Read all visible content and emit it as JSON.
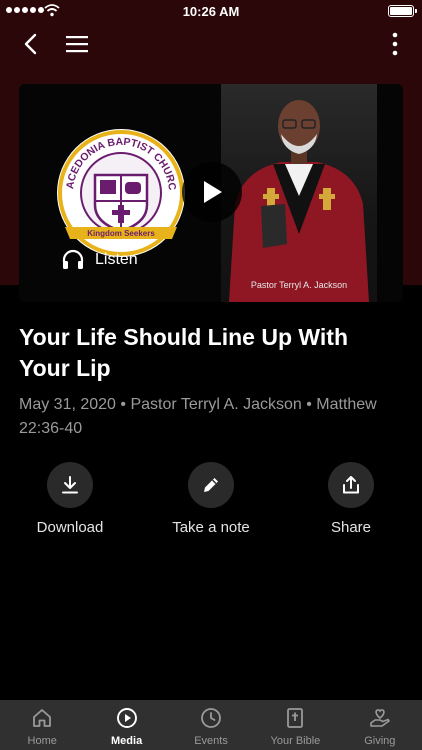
{
  "status_bar": {
    "time": "10:26 AM"
  },
  "hero": {
    "listen_label": "Listen",
    "photo_caption": "Pastor Terryl A. Jackson",
    "logo": {
      "church_name": "MACEDONIA BAPTIST CHURCH",
      "banner_text": "Kingdom Seekers"
    }
  },
  "sermon": {
    "title": "Your Life Should Line Up With Your Lip",
    "meta": "May 31, 2020 • Pastor Terryl A. Jackson • Matthew 22:36-40"
  },
  "actions": [
    {
      "label": "Download",
      "icon": "download-icon"
    },
    {
      "label": "Take a note",
      "icon": "pencil-icon"
    },
    {
      "label": "Share",
      "icon": "share-icon"
    }
  ],
  "tabs": [
    {
      "label": "Home",
      "icon": "home-icon"
    },
    {
      "label": "Media",
      "icon": "play-circle-icon"
    },
    {
      "label": "Events",
      "icon": "clock-icon"
    },
    {
      "label": "Your Bible",
      "icon": "bible-icon"
    },
    {
      "label": "Giving",
      "icon": "giving-hand-icon"
    }
  ],
  "active_tab": "Media",
  "colors": {
    "header_bg": "#2b0709",
    "page_bg": "#000000",
    "tabbar_bg": "#303030",
    "action_circle_bg": "#2a2a2a",
    "meta_text": "#9a9a9a"
  }
}
